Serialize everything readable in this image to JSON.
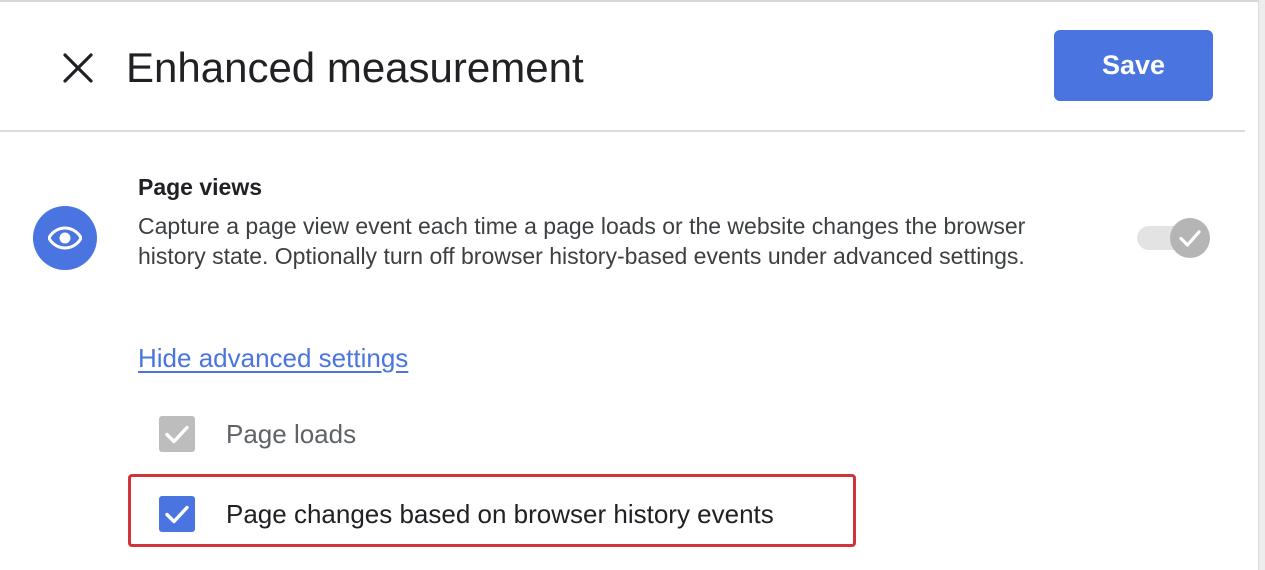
{
  "header": {
    "title": "Enhanced measurement",
    "save_label": "Save",
    "close_icon": "close-icon"
  },
  "section": {
    "icon": "eye-icon",
    "title": "Page views",
    "description": "Capture a page view event each time a page loads or the website changes the browser history state. Optionally turn off browser history-based events under advanced settings.",
    "toggle_state": "on-disabled",
    "advanced_link": "Hide advanced settings",
    "options": [
      {
        "label": "Page loads",
        "checked": true,
        "disabled": true
      },
      {
        "label": "Page changes based on browser history events",
        "checked": true,
        "disabled": false
      }
    ]
  },
  "colors": {
    "accent": "#4a75e0",
    "highlight": "#d13438",
    "disabled": "#bdbdbd"
  }
}
